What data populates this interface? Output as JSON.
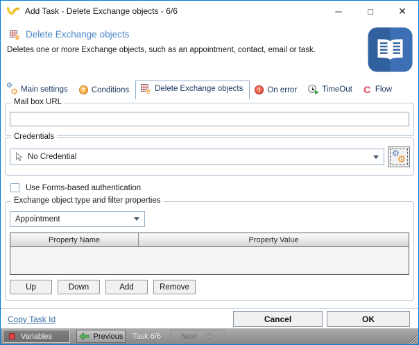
{
  "window": {
    "title": "Add Task - Delete Exchange objects - 6/6",
    "controls": {
      "minimize": "─",
      "maximize": "□",
      "close": "✕"
    }
  },
  "header": {
    "title": "Delete Exchange objects",
    "description": "Deletes one or more Exchange objects, such as an appointment, contact, email or task."
  },
  "tabs": [
    {
      "label": "Main settings",
      "icon": "gear-icon",
      "active": false
    },
    {
      "label": "Conditions",
      "icon": "question-icon",
      "active": false
    },
    {
      "label": "Delete Exchange objects",
      "icon": "delete-exchange-icon",
      "active": true
    },
    {
      "label": "On error",
      "icon": "error-icon",
      "active": false
    },
    {
      "label": "TimeOut",
      "icon": "timeout-clock-icon",
      "active": false
    },
    {
      "label": "Flow",
      "icon": "flow-arrow-icon",
      "active": false
    }
  ],
  "form": {
    "mailbox": {
      "label": "Mail box URL",
      "value": ""
    },
    "credentials": {
      "label": "Credentials",
      "selected": "No Credential"
    },
    "forms_auth": {
      "label": "Use Forms-based authentication",
      "checked": false
    },
    "exchange_filter": {
      "label": "Exchange object type and filter properties",
      "object_type": "Appointment",
      "table": {
        "columns": [
          "Property Name",
          "Property Value"
        ],
        "rows": []
      },
      "buttons": [
        "Up",
        "Down",
        "Add",
        "Remove"
      ]
    }
  },
  "footer": {
    "copy_task_link": "Copy Task Id",
    "cancel": "Cancel",
    "ok": "OK"
  },
  "statusbar": {
    "variables": "Variables",
    "previous": "Previous",
    "task_label": "Task 6/6",
    "next": "Next"
  },
  "colors": {
    "window_border": "#0079d8",
    "header_title_blue": "#4a86c5",
    "tab_text": "#17365d",
    "tab_underline": "#2b4a73",
    "link_blue": "#3a6ea5",
    "statusbar_gray": "#9a9a9a",
    "badge_orange": "#ef8d16",
    "error_red": "#dc4433",
    "flow_red": "#e4576e",
    "book_icon_blue": "#31609f"
  }
}
